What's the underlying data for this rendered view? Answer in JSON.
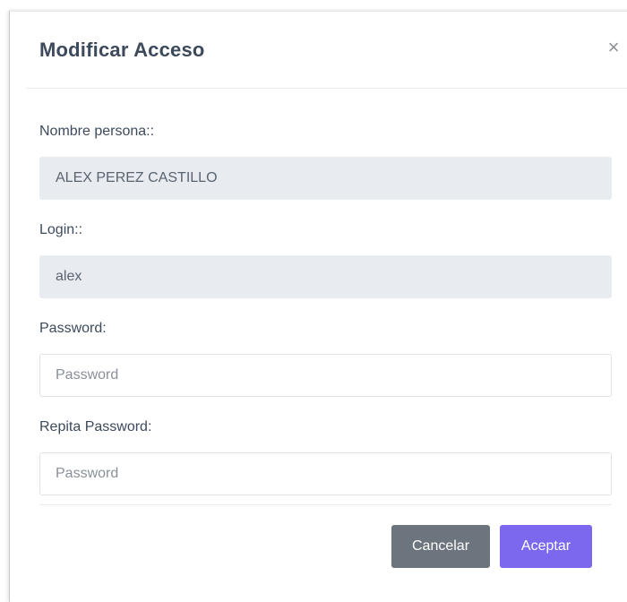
{
  "modal": {
    "title": "Modificar Acceso",
    "close_label": "×"
  },
  "form": {
    "nombre": {
      "label": "Nombre persona::",
      "value": "ALEX PEREZ CASTILLO"
    },
    "login": {
      "label": "Login::",
      "value": "alex"
    },
    "password": {
      "label": "Password:",
      "value": "",
      "placeholder": "Password"
    },
    "repeat_password": {
      "label": "Repita Password:",
      "value": "",
      "placeholder": "Password"
    }
  },
  "footer": {
    "cancel_label": "Cancelar",
    "accept_label": "Aceptar"
  },
  "colors": {
    "title": "#3d4a5c",
    "readonly_bg": "#e8ebef",
    "cancel_bg": "#6c757d",
    "accept_bg": "#7b68ee"
  }
}
